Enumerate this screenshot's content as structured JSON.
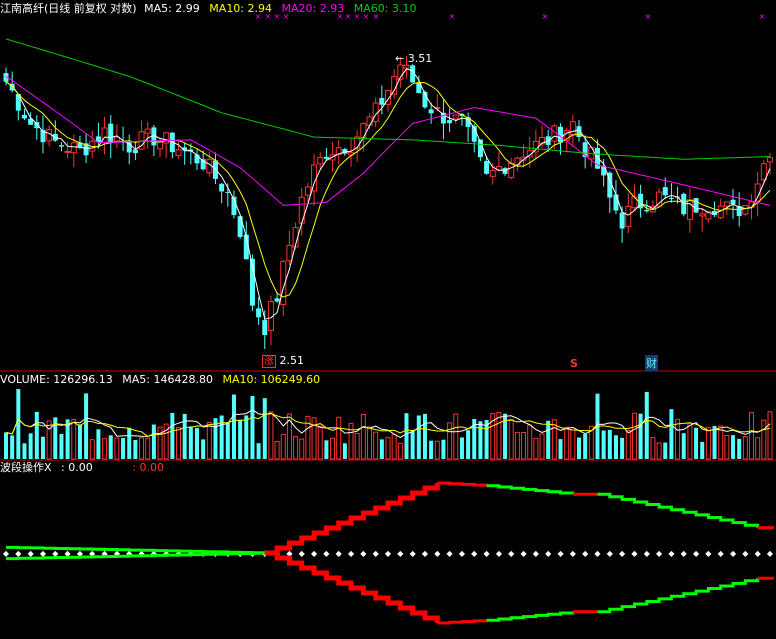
{
  "colors": {
    "background": "#000000",
    "up": "#ff3232",
    "down": "#54ffff",
    "ma5": "#ffffff",
    "ma10": "#ffff00",
    "ma20": "#ff00ff",
    "ma60": "#00cc00",
    "divider": "#c00000",
    "wave_up": "#ff0000",
    "wave_down": "#00ff00",
    "marker": "#ff00ff"
  },
  "price_header": {
    "title": "江南高纤(日线 前复权 对数)",
    "ma5": "MA5: 2.99",
    "ma10": "MA10: 2.94",
    "ma20": "MA20: 2.93",
    "ma60": "MA60: 3.10"
  },
  "volume_header": {
    "label": "VOLUME: 126296.13",
    "ma5": "MA5: 146428.80",
    "ma10": "MA10: 106249.60"
  },
  "indicator_header": {
    "label": "波段操作X",
    "value1": ": 0.00",
    "value2": ": 0.00"
  },
  "annotations": {
    "high": "3.51",
    "low": "2.51",
    "low_tag": "涨",
    "tag_s": "S",
    "tag_cai": "财"
  },
  "chart_data": [
    {
      "type": "candlestick",
      "panel": "price",
      "scale": "log",
      "num_bars": 125,
      "high_value": 3.51,
      "low_value": 2.51,
      "last_ma": {
        "ma5": 2.99,
        "ma10": 2.94,
        "ma20": 2.93,
        "ma60": 3.1
      },
      "close_anchors": [
        [
          0,
          3.38
        ],
        [
          4,
          3.22
        ],
        [
          8,
          3.15
        ],
        [
          12,
          3.12
        ],
        [
          16,
          3.19
        ],
        [
          20,
          3.14
        ],
        [
          24,
          3.17
        ],
        [
          28,
          3.13
        ],
        [
          32,
          3.08
        ],
        [
          36,
          2.97
        ],
        [
          38,
          2.85
        ],
        [
          40,
          2.62
        ],
        [
          42,
          2.55
        ],
        [
          44,
          2.64
        ],
        [
          46,
          2.8
        ],
        [
          48,
          2.95
        ],
        [
          50,
          3.05
        ],
        [
          52,
          3.12
        ],
        [
          56,
          3.15
        ],
        [
          60,
          3.26
        ],
        [
          62,
          3.35
        ],
        [
          64,
          3.45
        ],
        [
          66,
          3.38
        ],
        [
          68,
          3.3
        ],
        [
          70,
          3.26
        ],
        [
          74,
          3.22
        ],
        [
          78,
          3.02
        ],
        [
          80,
          3.06
        ],
        [
          84,
          3.12
        ],
        [
          88,
          3.16
        ],
        [
          92,
          3.22
        ],
        [
          94,
          3.13
        ],
        [
          96,
          3.06
        ],
        [
          98,
          2.95
        ],
        [
          100,
          2.88
        ],
        [
          102,
          2.93
        ],
        [
          106,
          2.96
        ],
        [
          110,
          2.92
        ],
        [
          114,
          2.94
        ],
        [
          118,
          2.91
        ],
        [
          120,
          2.93
        ],
        [
          122,
          3.02
        ],
        [
          124,
          3.13
        ]
      ],
      "ma_anchors": {
        "ma20": [
          [
            0,
            3.4
          ],
          [
            15,
            3.15
          ],
          [
            30,
            3.16
          ],
          [
            38,
            3.06
          ],
          [
            45,
            2.93
          ],
          [
            52,
            2.94
          ],
          [
            58,
            3.04
          ],
          [
            66,
            3.22
          ],
          [
            76,
            3.28
          ],
          [
            86,
            3.24
          ],
          [
            96,
            3.07
          ],
          [
            110,
            3.0
          ],
          [
            124,
            2.93
          ]
        ],
        "ma60": [
          [
            0,
            3.55
          ],
          [
            20,
            3.4
          ],
          [
            35,
            3.26
          ],
          [
            50,
            3.17
          ],
          [
            66,
            3.16
          ],
          [
            80,
            3.14
          ],
          [
            95,
            3.11
          ],
          [
            110,
            3.09
          ],
          [
            124,
            3.1
          ]
        ]
      }
    },
    {
      "type": "bar",
      "panel": "volume",
      "num_bars": 125,
      "last_volume": 126296.13,
      "ma5": 146428.8,
      "ma10": 106249.6
    },
    {
      "type": "step-line",
      "panel": "indicator",
      "name": "波段操作X",
      "segments": [
        {
          "start": 0,
          "end": 42,
          "color": "wave_down",
          "from": 0.08,
          "to": 0.0
        },
        {
          "start": 42,
          "end": 70,
          "color": "wave_up",
          "from": 0.0,
          "to": 1.0
        },
        {
          "start": 70,
          "end": 78,
          "color": "wave_up",
          "from": 1.0,
          "to": 0.96
        },
        {
          "start": 78,
          "end": 92,
          "color": "wave_down",
          "from": 0.96,
          "to": 0.84
        },
        {
          "start": 92,
          "end": 96,
          "color": "wave_up",
          "from": 0.84,
          "to": 0.84
        },
        {
          "start": 96,
          "end": 122,
          "color": "wave_down",
          "from": 0.84,
          "to": 0.36
        },
        {
          "start": 122,
          "end": 125,
          "color": "wave_up",
          "from": 0.36,
          "to": 0.36
        }
      ]
    }
  ]
}
